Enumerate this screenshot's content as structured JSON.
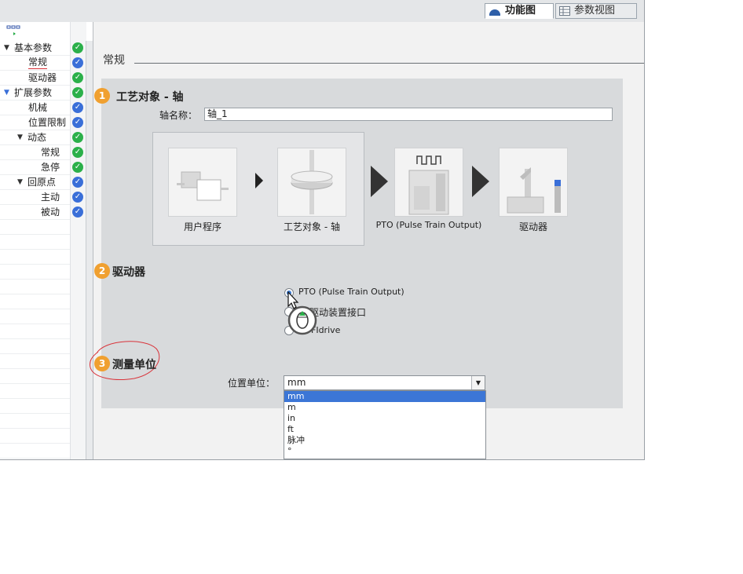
{
  "view_tabs": [
    {
      "label": "功能图",
      "icon": "function-view-icon",
      "active": true
    },
    {
      "label": "参数视图",
      "icon": "table-grid-icon",
      "active": false
    }
  ],
  "tree": {
    "items": [
      {
        "label": "基本参数",
        "level": 0,
        "expanded": true,
        "status": "green"
      },
      {
        "label": "常规",
        "level": 1,
        "selected": true,
        "status": "blue"
      },
      {
        "label": "驱动器",
        "level": 1,
        "status": "green"
      },
      {
        "label": "扩展参数",
        "level": 0,
        "expanded": true,
        "status": "green"
      },
      {
        "label": "机械",
        "level": 1,
        "status": "blue"
      },
      {
        "label": "位置限制",
        "level": 1,
        "status": "blue"
      },
      {
        "label": "动态",
        "level": 1,
        "expanded": true,
        "status": "green"
      },
      {
        "label": "常规",
        "level": 2,
        "status": "green"
      },
      {
        "label": "急停",
        "level": 2,
        "status": "green"
      },
      {
        "label": "回原点",
        "level": 1,
        "expanded": true,
        "status": "blue"
      },
      {
        "label": "主动",
        "level": 2,
        "status": "blue"
      },
      {
        "label": "被动",
        "level": 2,
        "status": "blue"
      }
    ]
  },
  "main": {
    "section_title": "常规",
    "step1": {
      "number": "1",
      "title": "工艺对象 - 轴"
    },
    "axis_name_label": "轴名称：",
    "axis_name_value": "轴_1",
    "flow": [
      {
        "label": "用户程序"
      },
      {
        "label": "工艺对象 - 轴"
      },
      {
        "label": "PTO (Pulse Train Output)"
      },
      {
        "label": "驱动器"
      }
    ],
    "step2": {
      "number": "2",
      "title": "驱动器"
    },
    "drive_options": [
      {
        "label": "PTO (Pulse Train Output)",
        "checked": true
      },
      {
        "label": "驱动装置接口",
        "checked": false
      },
      {
        "label": "FIdrive",
        "checked": false
      }
    ],
    "step3": {
      "number": "3",
      "title": "测量单位"
    },
    "position_unit_label": "位置单位：",
    "position_unit_value": "mm",
    "unit_options": [
      "mm",
      "m",
      "in",
      "ft",
      "脉冲",
      "°"
    ]
  }
}
